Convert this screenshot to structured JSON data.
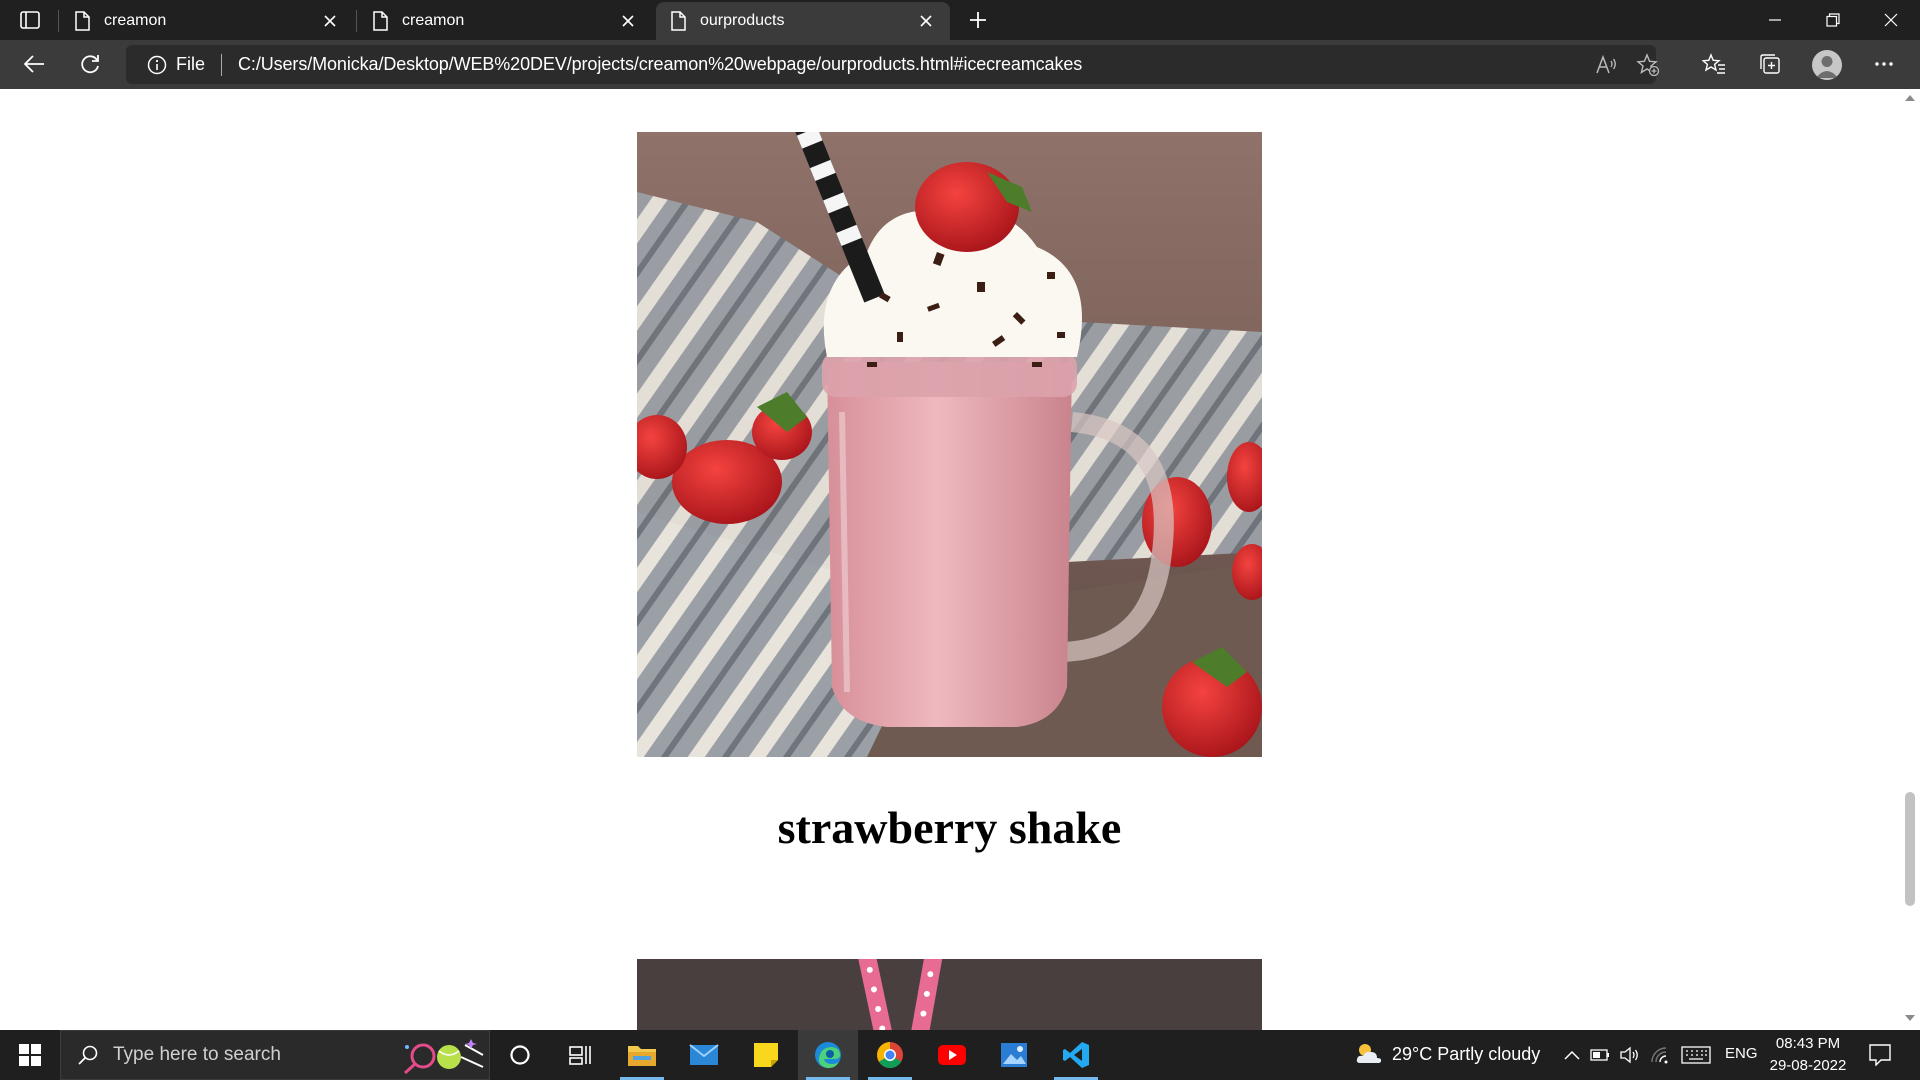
{
  "browser": {
    "tabs": [
      {
        "title": "creamon",
        "active": false
      },
      {
        "title": "creamon",
        "active": false
      },
      {
        "title": "ourproducts",
        "active": true
      }
    ],
    "address": {
      "scheme_label": "File",
      "url": "C:/Users/Monicka/Desktop/WEB%20DEV/projects/creamon%20webpage/ourproducts.html#icecreamcakes"
    }
  },
  "page": {
    "product_title": "strawberry shake"
  },
  "taskbar": {
    "search_placeholder": "Type here to search",
    "weather": "29°C  Partly cloudy",
    "language": "ENG",
    "time": "08:43 PM",
    "date": "29-08-2022"
  },
  "colors": {
    "titlebar": "#202020",
    "toolbar": "#3b3b3b",
    "taskbar": "#1f1f1f",
    "accent": "#76b9ed"
  }
}
